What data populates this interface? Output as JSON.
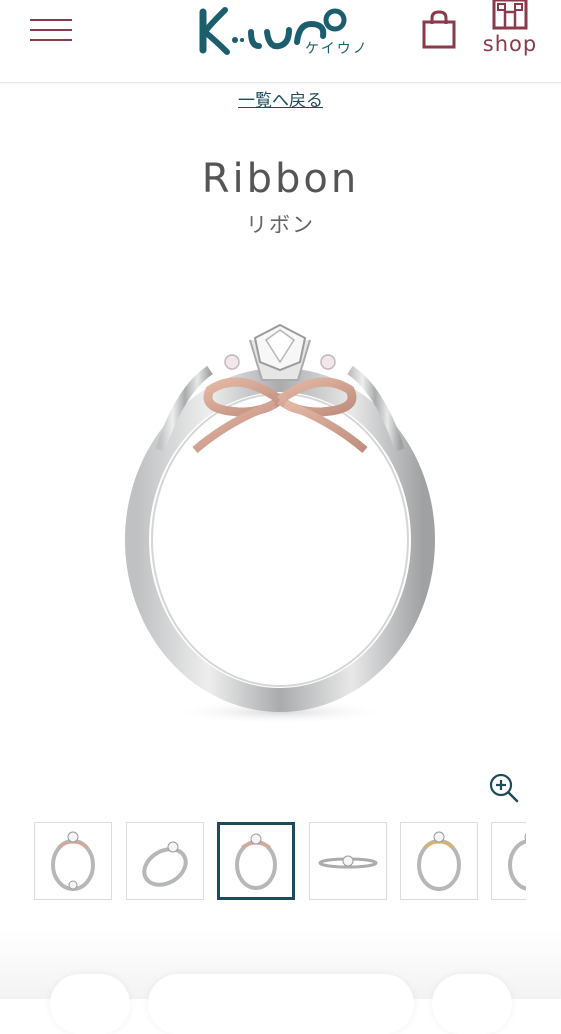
{
  "header": {
    "logo_text": "Keiuno",
    "logo_sub": "ケイウノ",
    "shop_label": "shop",
    "brand_color": "#8a3a4a",
    "logo_color": "#1d5e6e"
  },
  "back_link": "一覧へ戻る",
  "product": {
    "title": "Ribbon",
    "subtitle": "リボン"
  },
  "thumbnails": [
    {
      "icon": "ring-front-thumb",
      "selected": false
    },
    {
      "icon": "ring-angle-thumb",
      "selected": false
    },
    {
      "icon": "ring-front-pink-thumb",
      "selected": true
    },
    {
      "icon": "ring-flat-thumb",
      "selected": false
    },
    {
      "icon": "ring-gold-thumb",
      "selected": false
    },
    {
      "icon": "ring-partial-thumb",
      "selected": false
    }
  ],
  "accent_color": "#1f4a5c"
}
